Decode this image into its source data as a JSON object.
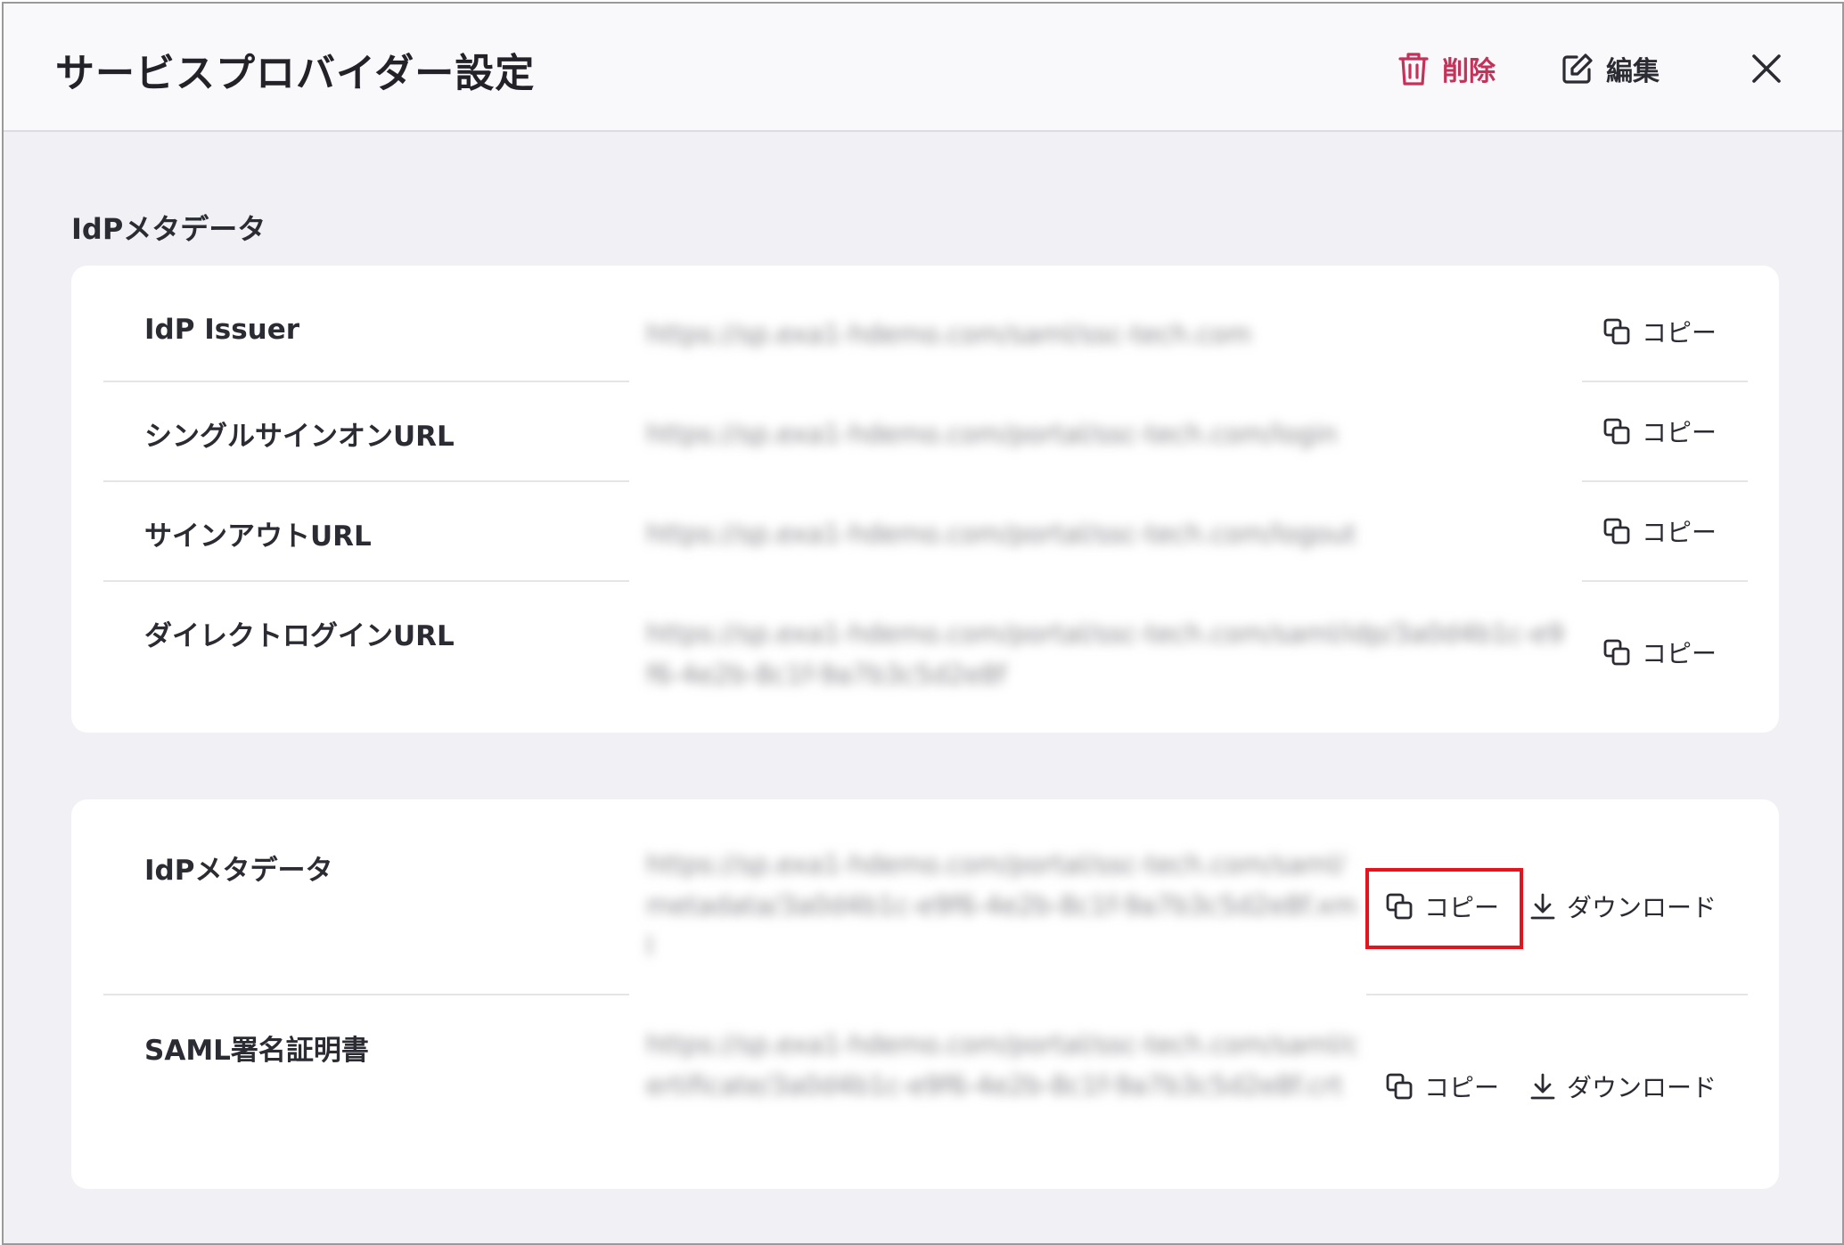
{
  "header": {
    "title": "サービスプロバイダー設定",
    "delete_label": "削除",
    "edit_label": "編集"
  },
  "section": {
    "title": "IdPメタデータ"
  },
  "card1": {
    "rows": [
      {
        "label": "IdP Issuer",
        "value": "https://sp.exa1-hdemo.com/saml/ssc-tech.com",
        "copy_label": "コピー"
      },
      {
        "label": "シングルサインオンURL",
        "value": "https://sp.exa1-hdemo.com/portal/ssc-tech.com/login",
        "copy_label": "コピー"
      },
      {
        "label": "サインアウトURL",
        "value": "https://sp.exa1-hdemo.com/portal/ssc-tech.com/logout",
        "copy_label": "コピー"
      },
      {
        "label": "ダイレクトログインURL",
        "value": "https://sp.exa1-hdemo.com/portal/ssc-tech.com/saml/idp/3a0d4b1c-e9f6-4e2b-8c1f-9a7b3c5d2e8f",
        "copy_label": "コピー"
      }
    ]
  },
  "card2": {
    "rows": [
      {
        "label": "IdPメタデータ",
        "value": "https://sp.exa1-hdemo.com/portal/ssc-tech.com/saml/metadata/3a0d4b1c-e9f6-4e2b-8c1f-9a7b3c5d2e8f.xml",
        "copy_label": "コピー",
        "download_label": "ダウンロード"
      },
      {
        "label": "SAML署名証明書",
        "value": "https://sp.exa1-hdemo.com/portal/ssc-tech.com/saml/certificate/3a0d4b1c-e9f6-4e2b-8c1f-9a7b3c5d2e8f.crt",
        "copy_label": "コピー",
        "download_label": "ダウンロード"
      }
    ]
  },
  "colors": {
    "accent_delete": "#c4325a",
    "highlight": "#e3141d",
    "background": "#f0f0f5"
  },
  "icons": {
    "delete": "trash-icon",
    "edit": "pencil-icon",
    "close": "close-icon",
    "copy": "copy-icon",
    "download": "download-icon"
  }
}
